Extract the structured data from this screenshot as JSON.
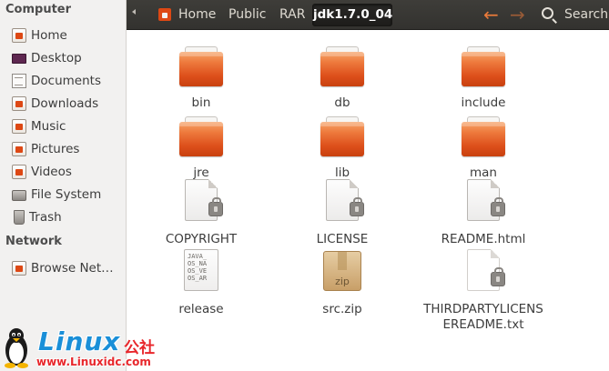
{
  "sidebar": {
    "computer_header": "Computer",
    "network_header": "Network",
    "items": [
      {
        "label": "Home",
        "icon": "home-folder-icon"
      },
      {
        "label": "Desktop",
        "icon": "desktop-icon"
      },
      {
        "label": "Documents",
        "icon": "documents-folder-icon"
      },
      {
        "label": "Downloads",
        "icon": "downloads-folder-icon"
      },
      {
        "label": "Music",
        "icon": "music-folder-icon"
      },
      {
        "label": "Pictures",
        "icon": "pictures-folder-icon"
      },
      {
        "label": "Videos",
        "icon": "videos-folder-icon"
      },
      {
        "label": "File System",
        "icon": "disk-icon"
      },
      {
        "label": "Trash",
        "icon": "trash-icon"
      }
    ],
    "network_items": [
      {
        "label": "Browse Net…",
        "icon": "network-folder-icon"
      }
    ]
  },
  "toolbar": {
    "breadcrumbs": [
      "Home",
      "Public",
      "RAR",
      "jdk1.7.0_04"
    ],
    "active_crumb": "jdk1.7.0_04",
    "back_glyph": "←",
    "forward_glyph": "→",
    "search_label": "Search"
  },
  "files": [
    {
      "name": "bin",
      "type": "folder"
    },
    {
      "name": "db",
      "type": "folder"
    },
    {
      "name": "include",
      "type": "folder"
    },
    {
      "name": "jre",
      "type": "folder"
    },
    {
      "name": "lib",
      "type": "folder"
    },
    {
      "name": "man",
      "type": "folder"
    },
    {
      "name": "COPYRIGHT",
      "type": "locked-document"
    },
    {
      "name": "LICENSE",
      "type": "locked-document"
    },
    {
      "name": "README.html",
      "type": "locked-document"
    },
    {
      "name": "release",
      "type": "text-document",
      "preview_lines": [
        "JAVA_",
        "OS_NA",
        "OS_VE",
        "OS_AR"
      ]
    },
    {
      "name": "src.zip",
      "type": "zip-archive",
      "badge": "zip"
    },
    {
      "name_line1": "THIRDPARTYLICENS",
      "name_line2": "EREADME.txt",
      "type": "locked-document"
    }
  ],
  "watermark": {
    "brand": "Linux",
    "chinese": "公社",
    "url": "www.Linuxidc.com"
  },
  "colors": {
    "accent_orange": "#dd4814",
    "toolbar_dark": "#3c3b37",
    "watermark_blue": "#1a8fd8",
    "watermark_red": "#e8262b"
  }
}
